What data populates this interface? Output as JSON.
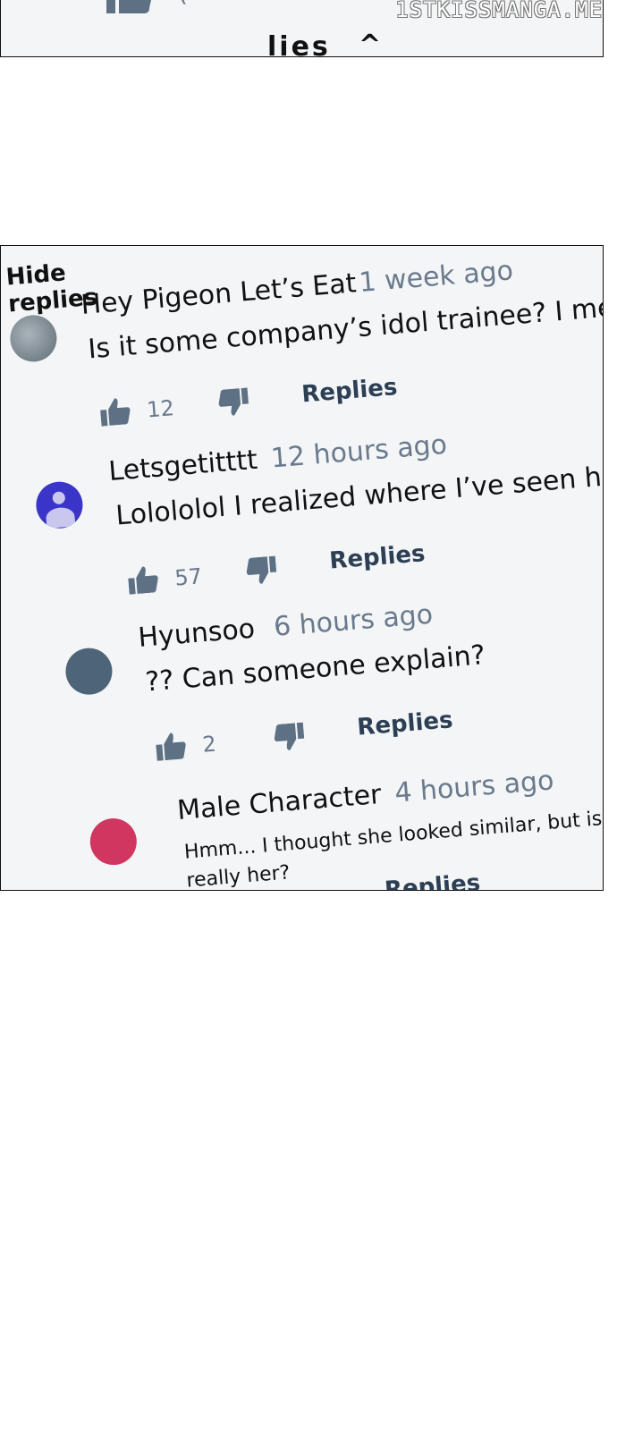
{
  "watermark": "1STKISSMANGA.ME",
  "top_panel": {
    "replies_label": "lies",
    "chevron": "^",
    "partial_count": "("
  },
  "hide_replies_label": "Hide replies",
  "comments": [
    {
      "username": "Hey Pigeon Let’s Eat",
      "timestamp": "1 week ago",
      "text": "Is it some company’s idol trainee? I mea",
      "likes": "12",
      "replies_label": "Replies",
      "avatar_color": "#6f7d86"
    },
    {
      "username": "Letsgetitttt",
      "timestamp": "12 hours ago",
      "text": "Lolololol I realized where I’ve seen he",
      "likes": "57",
      "replies_label": "Replies",
      "avatar_color": "#3a34c9"
    },
    {
      "username": "Hyunsoo",
      "timestamp": "6 hours ago",
      "text": "?? Can someone explain?",
      "likes": "2",
      "replies_label": "Replies",
      "avatar_color": "#4e6478"
    },
    {
      "username": "Male Character",
      "timestamp": "4 hours ago",
      "text_line1": "Hmm... I thought she looked similar, but is it",
      "text_line2": "really her?",
      "replies_label": "Replies",
      "avatar_color": "#d03660"
    }
  ]
}
